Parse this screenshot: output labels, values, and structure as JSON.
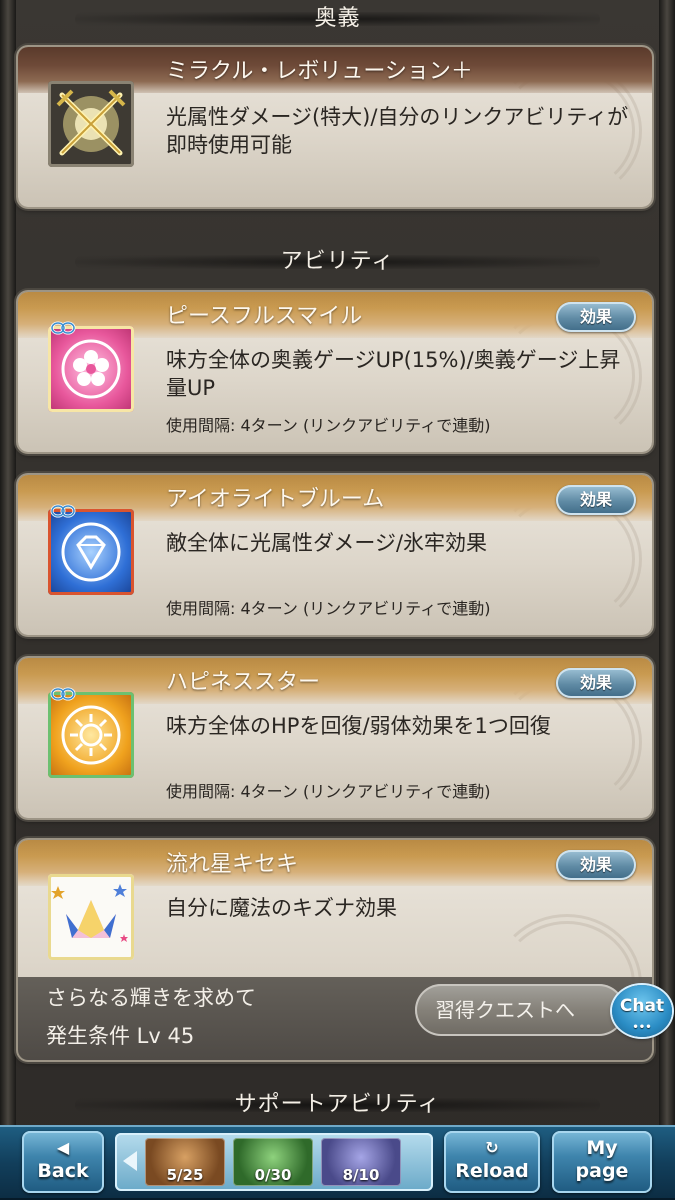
{
  "sections": {
    "ougi": "奥義",
    "ability": "アビリティ",
    "support": "サポートアビリティ"
  },
  "charge_attack": {
    "name": "ミラクル・レボリューション＋",
    "description": "光属性ダメージ(特大)/自分のリンクアビリティが即時使用可能",
    "icon": "crossed-swords-icon"
  },
  "abilities": [
    {
      "name": "ピースフルスマイル",
      "description": "味方全体の奥義ゲージUP(15%)/奥義ゲージ上昇量UP",
      "cooldown": "使用間隔: 4ターン (リンクアビリティで連動)",
      "effect_label": "効果",
      "icon": "flower-icon",
      "color": "#e8589c"
    },
    {
      "name": "アイオライトブルーム",
      "description": "敵全体に光属性ダメージ/氷牢効果",
      "cooldown": "使用間隔: 4ターン (リンクアビリティで連動)",
      "effect_label": "効果",
      "icon": "diamond-icon",
      "color": "#2f6fd6"
    },
    {
      "name": "ハピネススター",
      "description": "味方全体のHPを回復/弱体効果を1つ回復",
      "cooldown": "使用間隔: 4ターン (リンクアビリティで連動)",
      "effect_label": "効果",
      "icon": "sun-icon",
      "color": "#f0a21e"
    },
    {
      "name": "流れ星キセキ",
      "description": "自分に魔法のキズナ効果",
      "effect_label": "効果",
      "icon": "crown-icon",
      "unlock_title": "さらなる輝きを求めて",
      "unlock_condition": "発生条件 Lv 45",
      "quest_button": "習得クエストへ"
    }
  ],
  "chat_label": "Chat",
  "chat_dots": "•••",
  "nav": {
    "back_label": "Back",
    "reload_label": "Reload",
    "my_label": "My",
    "page_label": "page",
    "party": [
      {
        "count": "5/25",
        "color": "#7a4a22"
      },
      {
        "count": "0/30",
        "color": "#2f6a2a"
      },
      {
        "count": "8/10",
        "color": "#4a4a8a"
      }
    ]
  }
}
